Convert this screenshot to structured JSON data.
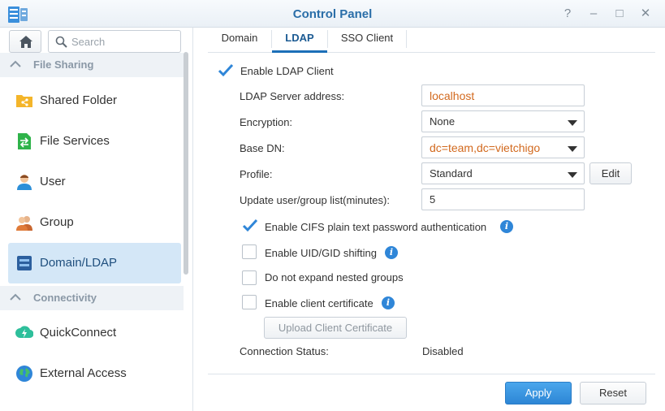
{
  "window": {
    "title": "Control Panel",
    "controls": {
      "help": "?",
      "minimize": "–",
      "maximize": "□",
      "close": "✕"
    }
  },
  "sidebar": {
    "search_placeholder": "Search",
    "sections": [
      {
        "label": "File Sharing"
      },
      {
        "label": "Connectivity"
      }
    ],
    "items": [
      {
        "label": "Shared Folder",
        "icon": "folder-share-icon"
      },
      {
        "label": "File Services",
        "icon": "file-services-icon"
      },
      {
        "label": "User",
        "icon": "user-icon"
      },
      {
        "label": "Group",
        "icon": "group-icon"
      },
      {
        "label": "Domain/LDAP",
        "icon": "domain-ldap-icon",
        "active": true
      },
      {
        "label": "QuickConnect",
        "icon": "quickconnect-icon"
      },
      {
        "label": "External Access",
        "icon": "globe-icon"
      }
    ]
  },
  "tabs": [
    {
      "label": "Domain"
    },
    {
      "label": "LDAP",
      "active": true
    },
    {
      "label": "SSO Client"
    }
  ],
  "form": {
    "enable_ldap": {
      "label": "Enable LDAP Client",
      "checked": true
    },
    "server_address": {
      "label": "LDAP Server address:",
      "value": "localhost"
    },
    "encryption": {
      "label": "Encryption:",
      "value": "None"
    },
    "base_dn": {
      "label": "Base DN:",
      "value": "dc=team,dc=vietchigo"
    },
    "profile": {
      "label": "Profile:",
      "value": "Standard",
      "edit_label": "Edit"
    },
    "update_list": {
      "label": "Update user/group list(minutes):",
      "value": "5"
    },
    "cifs": {
      "label": "Enable CIFS plain text password authentication",
      "checked": true
    },
    "uid_gid": {
      "label": "Enable UID/GID shifting",
      "checked": false
    },
    "nested": {
      "label": "Do not expand nested groups",
      "checked": false
    },
    "client_cert": {
      "label": "Enable client certificate",
      "checked": false
    },
    "upload_cert_label": "Upload Client Certificate",
    "connection_status": {
      "label": "Connection Status:",
      "value": "Disabled"
    }
  },
  "footer": {
    "apply_label": "Apply",
    "reset_label": "Reset"
  },
  "colors": {
    "accent": "#2a6ea8",
    "active_bg": "#d4e7f7",
    "value_orange": "#d2691e",
    "primary_button": "#3a97e0"
  }
}
